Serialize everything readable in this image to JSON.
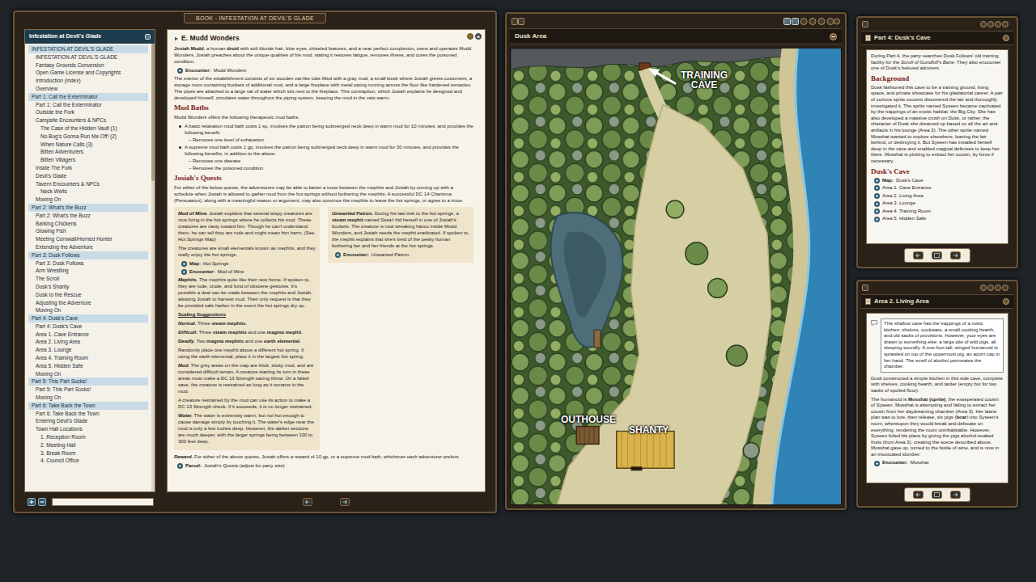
{
  "book": {
    "title": "BOOK - INFESTATION AT DEVIL'S GLADE",
    "toc": {
      "title": "Infestation at Devil's Glade",
      "items": [
        {
          "label": "INFESTATION AT DEVIL'S GLADE",
          "kind": "section"
        },
        {
          "label": "INFESTATION AT DEVIL'S GLADE",
          "kind": "item"
        },
        {
          "label": "Fantasy Grounds Conversion",
          "kind": "item"
        },
        {
          "label": "Open Game License and Copyrights",
          "kind": "item"
        },
        {
          "label": "Introduction (index)",
          "kind": "item"
        },
        {
          "label": "Overview",
          "kind": "item"
        },
        {
          "label": "Part 1: Call the Exterminator",
          "kind": "section"
        },
        {
          "label": "Part 1: Call the Exterminator",
          "kind": "item"
        },
        {
          "label": "Outside the Fork",
          "kind": "item"
        },
        {
          "label": "Campsite Encounters & NPCs",
          "kind": "item"
        },
        {
          "label": "The Case of the Hidden Vault (1)",
          "kind": "sub"
        },
        {
          "label": "No Bug's Gonna Run Me Off! (2)",
          "kind": "sub"
        },
        {
          "label": "When Nature Calls (3)",
          "kind": "sub"
        },
        {
          "label": "Bitten Adventurers",
          "kind": "sub"
        },
        {
          "label": "Bitten Villagers",
          "kind": "sub"
        },
        {
          "label": "Inside The Fork",
          "kind": "item"
        },
        {
          "label": "Devil's Glade",
          "kind": "item"
        },
        {
          "label": "Tavern Encounters & NPCs",
          "kind": "item"
        },
        {
          "label": "Neck Welts",
          "kind": "sub"
        },
        {
          "label": "Moving On",
          "kind": "item"
        },
        {
          "label": "Part 2: What's the Buzz",
          "kind": "section"
        },
        {
          "label": "Part 2: What's the Buzz",
          "kind": "item"
        },
        {
          "label": "Barking Chickens",
          "kind": "item"
        },
        {
          "label": "Glowing Fish",
          "kind": "item"
        },
        {
          "label": "Meeting Cornwall/Horned Hunter",
          "kind": "item"
        },
        {
          "label": "Extending the Adventure",
          "kind": "item"
        },
        {
          "label": "Part 3: Dusk Follows",
          "kind": "section"
        },
        {
          "label": "Part 3: Dusk Follows",
          "kind": "item"
        },
        {
          "label": "Arm Wrestling",
          "kind": "item"
        },
        {
          "label": "The Scroll",
          "kind": "item"
        },
        {
          "label": "Dusk's Shanty",
          "kind": "item"
        },
        {
          "label": "Dusk to the Rescue",
          "kind": "item"
        },
        {
          "label": "Adjusting the Adventure",
          "kind": "item"
        },
        {
          "label": "Moving On",
          "kind": "item"
        },
        {
          "label": "Part 4: Dusk's Cave",
          "kind": "section"
        },
        {
          "label": "Part 4: Dusk's Cave",
          "kind": "item"
        },
        {
          "label": "Area 1. Cave Entrance",
          "kind": "item"
        },
        {
          "label": "Area 2. Living Area",
          "kind": "item"
        },
        {
          "label": "Area 3. Lounge",
          "kind": "item"
        },
        {
          "label": "Area 4. Training Room",
          "kind": "item"
        },
        {
          "label": "Area 5. Hidden Safe",
          "kind": "item"
        },
        {
          "label": "Moving On",
          "kind": "item"
        },
        {
          "label": "Part 5: This Part Sucks!",
          "kind": "section"
        },
        {
          "label": "Part 5: This Part Sucks!",
          "kind": "item"
        },
        {
          "label": "Moving On",
          "kind": "item"
        },
        {
          "label": "Part 6: Take Back the Town",
          "kind": "section"
        },
        {
          "label": "Part 6: Take Back the Town",
          "kind": "item"
        },
        {
          "label": "Entering Devil's Glade",
          "kind": "item"
        },
        {
          "label": "Town Hall Locations",
          "kind": "item"
        },
        {
          "label": "1. Reception Room",
          "kind": "sub"
        },
        {
          "label": "2. Meeting Hall",
          "kind": "sub"
        },
        {
          "label": "3. Break Room",
          "kind": "sub"
        },
        {
          "label": "4. Council Office",
          "kind": "sub"
        }
      ]
    },
    "content": [
      {
        "kind": "title",
        "text": "E. Mudd Wonders"
      },
      {
        "kind": "p",
        "runs": [
          {
            "text": "Josiah Mudd",
            "style": "b"
          },
          {
            "text": ", a human ",
            "style": ""
          },
          {
            "text": "druid",
            "style": "b"
          },
          {
            "text": " with soft blonde hair, blue eyes, chiseled features, and a near perfect complexion, owns and operates Mudd Wonders. Josiah preaches about the unique qualities of his mud, stating it restores fatigue, removes illness, and cures the poisoned condition.",
            "style": ""
          }
        ]
      },
      {
        "kind": "link",
        "label": "Encounter:",
        "text": "Mudd Wonders"
      },
      {
        "kind": "p",
        "runs": [
          {
            "text": "The interior of the establishment consists of six wooden vat-like tubs filled with a gray mud, a small kiosk where Josiah greets customers, a storage room containing buckets of additional mud, and a large fireplace with metal piping running across the floor like hardened tentacles. The pipes are attached to a large vat of water which sits next to the fireplace. This contraption, which Josiah explains he designed and developed himself, circulates water throughout the piping system, keeping the mud in the vats warm.",
            "style": ""
          }
        ]
      },
      {
        "kind": "heading",
        "text": "Mud Baths"
      },
      {
        "kind": "p",
        "runs": [
          {
            "text": "Mudd Wonders offers the following therapeutic mud baths.",
            "style": ""
          }
        ]
      },
      {
        "kind": "bullet",
        "runs": [
          {
            "text": "A basic relaxation mud bath costs 1 sp, involves the patron being submerged neck deep in warm mud for 10 minutes, and provides the following benefit.",
            "style": ""
          }
        ]
      },
      {
        "kind": "dash",
        "text": "– Removes one level of exhaustion"
      },
      {
        "kind": "bullet",
        "runs": [
          {
            "text": "A supreme mud bath costs 1 gp, involves the patron being submerged neck deep in warm mud for 30 minutes, and provides the following benefits, in addition to the above.",
            "style": ""
          }
        ]
      },
      {
        "kind": "dash",
        "text": "– Removes one disease"
      },
      {
        "kind": "dash",
        "text": "– Removes the poisoned condition"
      },
      {
        "kind": "heading",
        "text": "Josiah's Quests"
      },
      {
        "kind": "p",
        "runs": [
          {
            "text": "For either of the below quests, the adventurers may be able to barter a truce between the mephits and Josiah by coming up with a schedule when Josiah is allowed to gather mud from the hot springs without bothering the mephits. A successful DC 14 Charisma (Persuasion), along with a meaningful reason or argument, may also convince the mephits to leave the hot springs, or agree to a truce.",
            "style": ""
          }
        ]
      },
      {
        "kind": "boxes",
        "columns": [
          [
            {
              "kind": "p",
              "runs": [
                {
                  "text": "Mud of Mine.",
                  "style": "bi"
                },
                {
                  "text": " Josiah explains that several wispy creatures are now living in the hot springs where he collects his mud. These creatures are nasty toward him. Though he can't understand them, he can tell they are rude and might mean him harm. (See Hot Springs Map)",
                  "style": ""
                }
              ]
            },
            {
              "kind": "p",
              "runs": [
                {
                  "text": "The creatures are small elementals known as mephits, and they really enjoy the hot springs.",
                  "style": ""
                }
              ]
            },
            {
              "kind": "link",
              "label": "Map:",
              "text": "Hot Springs"
            },
            {
              "kind": "link",
              "label": "Encounter:",
              "text": "Mud of Mine"
            },
            {
              "kind": "p",
              "runs": [
                {
                  "text": "Mephits.",
                  "style": "bi"
                },
                {
                  "text": " The mephits quite like their new home. If spoken to, they are rude, crude, and fond of obscene gestures. It's possible a deal can be made between the mephits and Josiah, allowing Josiah to harvest mud. Their only request is that they be provided safe harbor in the event the hot springs dry up.",
                  "style": ""
                }
              ]
            },
            {
              "kind": "p",
              "runs": [
                {
                  "text": "Scaling Suggestions",
                  "style": "bu"
                }
              ]
            },
            {
              "kind": "p",
              "runs": [
                {
                  "text": "Normal.",
                  "style": "bi"
                },
                {
                  "text": " Three ",
                  "style": ""
                },
                {
                  "text": "steam mephits",
                  "style": "b"
                },
                {
                  "text": ".",
                  "style": ""
                }
              ]
            },
            {
              "kind": "p",
              "runs": [
                {
                  "text": "Difficult.",
                  "style": "bi"
                },
                {
                  "text": " Three ",
                  "style": ""
                },
                {
                  "text": "steam mephits",
                  "style": "b"
                },
                {
                  "text": " and one ",
                  "style": ""
                },
                {
                  "text": "magma mephit",
                  "style": "b"
                },
                {
                  "text": ".",
                  "style": ""
                }
              ]
            },
            {
              "kind": "p",
              "runs": [
                {
                  "text": "Deadly.",
                  "style": "bi"
                },
                {
                  "text": " Two ",
                  "style": ""
                },
                {
                  "text": "magma mephits",
                  "style": "b"
                },
                {
                  "text": " and one ",
                  "style": ""
                },
                {
                  "text": "earth elemental",
                  "style": "b"
                },
                {
                  "text": ".",
                  "style": ""
                }
              ]
            },
            {
              "kind": "p",
              "runs": [
                {
                  "text": "Randomly place one mephit above a different hot spring. If using the earth elemental, place it in the largest hot spring.",
                  "style": ""
                }
              ]
            },
            {
              "kind": "p",
              "runs": [
                {
                  "text": "Mud.",
                  "style": "bi"
                },
                {
                  "text": " The grey areas on the map are thick, sticky mud, and are considered difficult terrain. A creature starting its turn in these areas must make a DC 13 Strength saving throw. On a failed save, the creature is restrained as long as it remains in the mud.",
                  "style": ""
                }
              ]
            },
            {
              "kind": "p",
              "runs": [
                {
                  "text": "A creature restrained by the mud can use its action to make a DC 13 Strength check. If it succeeds, it is no longer restrained.",
                  "style": ""
                }
              ]
            },
            {
              "kind": "p",
              "runs": [
                {
                  "text": "Water.",
                  "style": "bi"
                },
                {
                  "text": " The water is extremely warm, but not hot enough to cause damage simply by touching it. The water's edge near the mud is only a few inches deep. However, the darker sections are much deeper, with the larger springs being between 100 to 300 feet deep.",
                  "style": ""
                }
              ]
            }
          ],
          [
            {
              "kind": "p",
              "runs": [
                {
                  "text": "Unwanted Patron.",
                  "style": "bi"
                },
                {
                  "text": " During his last trek to the hot springs, a ",
                  "style": ""
                },
                {
                  "text": "steam mephit",
                  "style": "b"
                },
                {
                  "text": " named Sssa't hid herself in one of Josiah's buckets. The creature is now wreaking havoc inside Mudd Wonders, and Josiah needs the mephit eradicated. If spoken to, the mephit explains that she's tired of the pesky human bothering her and her friends at the hot springs.",
                  "style": ""
                }
              ]
            },
            {
              "kind": "link",
              "label": "Encounter:",
              "text": "Unwanted Patron"
            }
          ]
        ]
      },
      {
        "kind": "p",
        "runs": [
          {
            "text": "Reward.",
            "style": "bi"
          },
          {
            "text": " For either of the above quests, Josiah offers a reward of 10 gp, or a supreme mud bath, whichever each adventurer prefers.",
            "style": ""
          }
        ]
      },
      {
        "kind": "link",
        "label": "Parcel:",
        "text": "Josiah's Quests (adjust for party size)"
      }
    ]
  },
  "map": {
    "title": "Dusk Area",
    "labels": [
      {
        "text": "TRAINING CAVE"
      },
      {
        "text": "OUTHOUSE"
      },
      {
        "text": "SHANTY"
      }
    ]
  },
  "stories": [
    {
      "title": "Part 4: Dusk's Cave",
      "blocks": [
        {
          "kind": "p",
          "runs": [
            {
              "text": "During Part 4, the party searches Dusk Follows' old training facility for the ",
              "style": ""
            },
            {
              "text": "Scroll of Gundfolf's Bane",
              "style": "i"
            },
            {
              "text": ". They also encounter one of Dusk's beloved admirers.",
              "style": ""
            }
          ]
        },
        {
          "kind": "heading",
          "text": "Background"
        },
        {
          "kind": "p",
          "runs": [
            {
              "text": "Dusk fashioned this cave to be a training ground, living space, and private showcase for his gladiatorial career. A pair of curious sprite cousins discovered the lair and thoroughly investigated it. The sprite named Syseen became captivated by the trappings of an exotic habitat: the Big City. She has also developed a massive crush on Dusk, or rather, the character of Dusk she dreamed up based on all the art and artifacts in his lounge (Area 3). The other sprite named Mosshat wanted to explore elsewhere, leaving the lair behind, or destroying it. But Syseen has installed herself deep in the cave and enabled magical defenses to keep her there. Mosshat is plotting to extract her cousin, by force if necessary.",
              "style": ""
            }
          ]
        },
        {
          "kind": "heading",
          "text": "Dusk's Cave"
        },
        {
          "kind": "link",
          "label": "Map:",
          "text": "Dusk's Cave"
        },
        {
          "kind": "link",
          "text": "Area 1. Cave Entrance"
        },
        {
          "kind": "link",
          "text": "Area 2. Living Area"
        },
        {
          "kind": "link",
          "text": "Area 3. Lounge"
        },
        {
          "kind": "link",
          "text": "Area 4. Training Room"
        },
        {
          "kind": "link",
          "text": "Area 5. Hidden Safe"
        }
      ]
    },
    {
      "title": "Area 2. Living Area",
      "blocks": [
        {
          "kind": "readaloud",
          "runs": [
            {
              "text": "This shallow cave has the trappings of a rustic kitchen: shelves, cookware, a small cooking hearth, and old sacks of provisions. However, your eyes are drawn to something else: a large pile of wild pigs, all sleeping soundly. A one-foot-tall, winged humanoid is sprawled on top of the uppermost pig, an acorn cap in her hand. The smell of alcohol permeates the chamber.",
              "style": ""
            }
          ]
        },
        {
          "kind": "p",
          "runs": [
            {
              "text": "Dusk constructed a simple kitchen in this side cave, complete with shelves, cooking hearth, and larder (empty but for two sacks of spoiled flour).",
              "style": ""
            }
          ]
        },
        {
          "kind": "p",
          "runs": [
            {
              "text": "The humanoid is ",
              "style": ""
            },
            {
              "text": "Mosshat (sprite)",
              "style": "b"
            },
            {
              "text": ", the exasperated cousin of Syseen. Mosshat is attempting and failing to extract her cousin from her daydreaming chamber (Area 3). Her latest plan was to lure, then release, six pigs (",
              "style": ""
            },
            {
              "text": "boar",
              "style": "b"
            },
            {
              "text": ") into Syseen's room, whereupon they would break and defecate on everything, rendering the room uninhabitable. However, Syseen foiled his plans by giving the pigs alcohol-soaked fruits (from Area 3), creating the scene described above. Mosshat gave up, turned to the bottle of wine, and is now in an intoxicated slumber.",
              "style": ""
            }
          ]
        },
        {
          "kind": "link",
          "label": "Encounter:",
          "text": "Mosshat"
        }
      ]
    }
  ]
}
